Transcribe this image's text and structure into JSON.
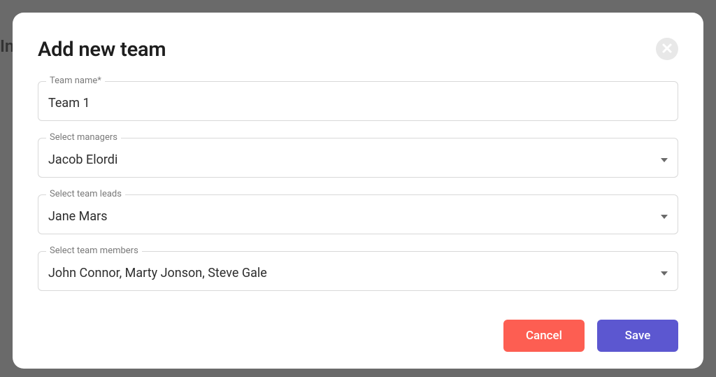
{
  "modal": {
    "title": "Add new team",
    "fields": {
      "team_name": {
        "label": "Team name*",
        "value": "Team 1"
      },
      "managers": {
        "label": "Select managers",
        "value": "Jacob Elordi"
      },
      "team_leads": {
        "label": "Select team leads",
        "value": "Jane Mars"
      },
      "team_members": {
        "label": "Select team members",
        "value": "John Connor, Marty Jonson, Steve Gale"
      }
    },
    "buttons": {
      "cancel": "Cancel",
      "save": "Save"
    }
  }
}
